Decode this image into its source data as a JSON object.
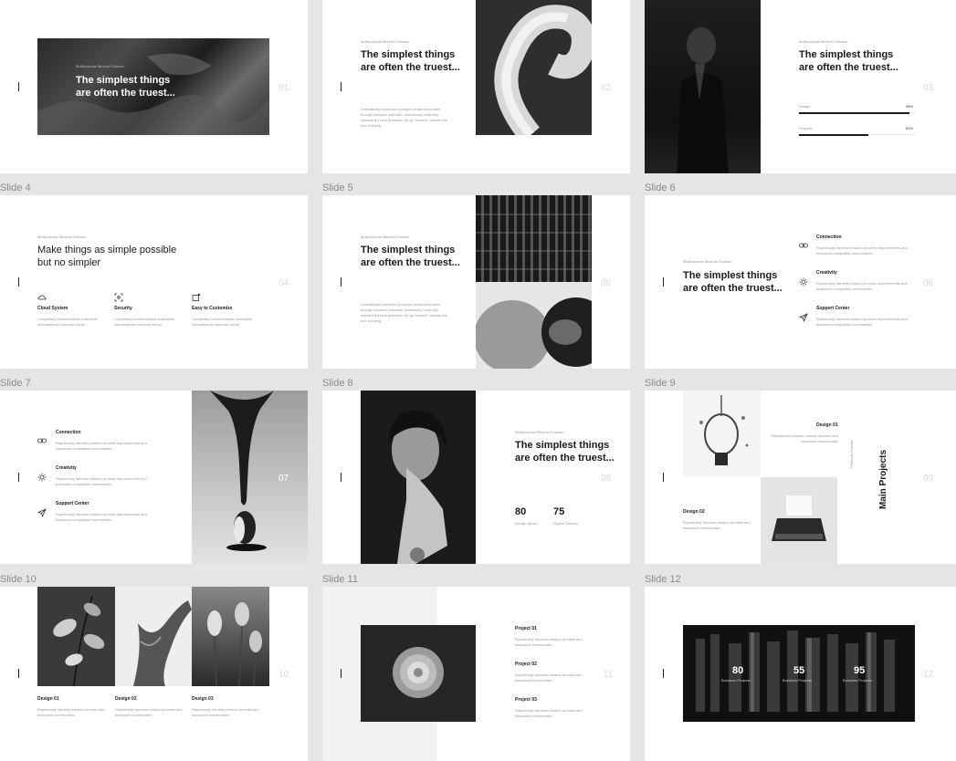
{
  "slide_labels": [
    "Slide 4",
    "Slide 5",
    "Slide 6",
    "Slide 7",
    "Slide 8",
    "Slide 9",
    "Slide 10",
    "Slide 11",
    "Slide 12"
  ],
  "page_numbers": [
    "01",
    "02",
    "03",
    "04",
    "05",
    "06",
    "07",
    "08",
    "09",
    "10",
    "11",
    "12"
  ],
  "kicker": "Multipurpose Minimal Solution",
  "headline": "The simplest things are often the truest...",
  "body_text": "Dramatically maximize principle-centered models through focused materials. Assertively build fully researched best practices via 'go forward' 'outside the box' thinking.",
  "slide3": {
    "skills": [
      {
        "label": "Design",
        "value": "95%",
        "fraction": 0.95
      },
      {
        "label": "Projects",
        "value": "60%",
        "fraction": 0.6
      }
    ]
  },
  "slide4": {
    "headline": "Make things as simple possible but no simpler",
    "features": [
      {
        "title": "Cloud System",
        "text": "Completely reintermediate extensible infomediaries whereas virtual",
        "icon": "cloud-icon"
      },
      {
        "title": "Security",
        "text": "Completely reintermediate extensible infomediaries whereas virtual",
        "icon": "security-icon"
      },
      {
        "title": "Easy to Customize",
        "text": "Completely reintermediate extensible infomediaries whereas virtual",
        "icon": "customize-icon"
      }
    ]
  },
  "services": [
    {
      "title": "Connection",
      "text": "Rapidiously harness mission process improvements and backward-compatible communities",
      "icon": "link-icon"
    },
    {
      "title": "Creativity",
      "text": "Rapidiously harness mission process improvements and backward-compatible communities",
      "icon": "sun-icon"
    },
    {
      "title": "Support Center",
      "text": "Rapidiously harness mission process improvements and backward-compatible communities",
      "icon": "send-icon"
    }
  ],
  "slide8": {
    "stats": [
      {
        "value": "80",
        "label": "Design Sprint"
      },
      {
        "value": "75",
        "label": "Pigma Themes"
      }
    ]
  },
  "slide9": {
    "design1_title": "Design 01",
    "design1_text": "Rapidiously harness mission process and backward communities",
    "design2_title": "Design 02",
    "design2_text": "Rapidiously harness mission process and backward communities",
    "vertical_kicker": "Personal Solution",
    "vertical_title": "Main Projects"
  },
  "slide10": {
    "designs": [
      {
        "title": "Design 01",
        "text": "Rapidiously harness mission process and backward communities"
      },
      {
        "title": "Design 02",
        "text": "Rapidiously harness mission process and backward communities"
      },
      {
        "title": "Design 03",
        "text": "Rapidiously harness mission process and backward communities"
      }
    ]
  },
  "slide11": {
    "projects": [
      {
        "title": "Project 01",
        "text": "Rapidiously harness mission process and backward communities"
      },
      {
        "title": "Project 02",
        "text": "Rapidiously harness mission process and backward communities"
      },
      {
        "title": "Project 03",
        "text": "Rapidiously harness mission process and backward communities"
      }
    ]
  },
  "slide12": {
    "stats": [
      {
        "value": "80",
        "label": "Business Projects"
      },
      {
        "value": "55",
        "label": "Business Projects"
      },
      {
        "value": "95",
        "label": "Business Projects"
      }
    ]
  }
}
